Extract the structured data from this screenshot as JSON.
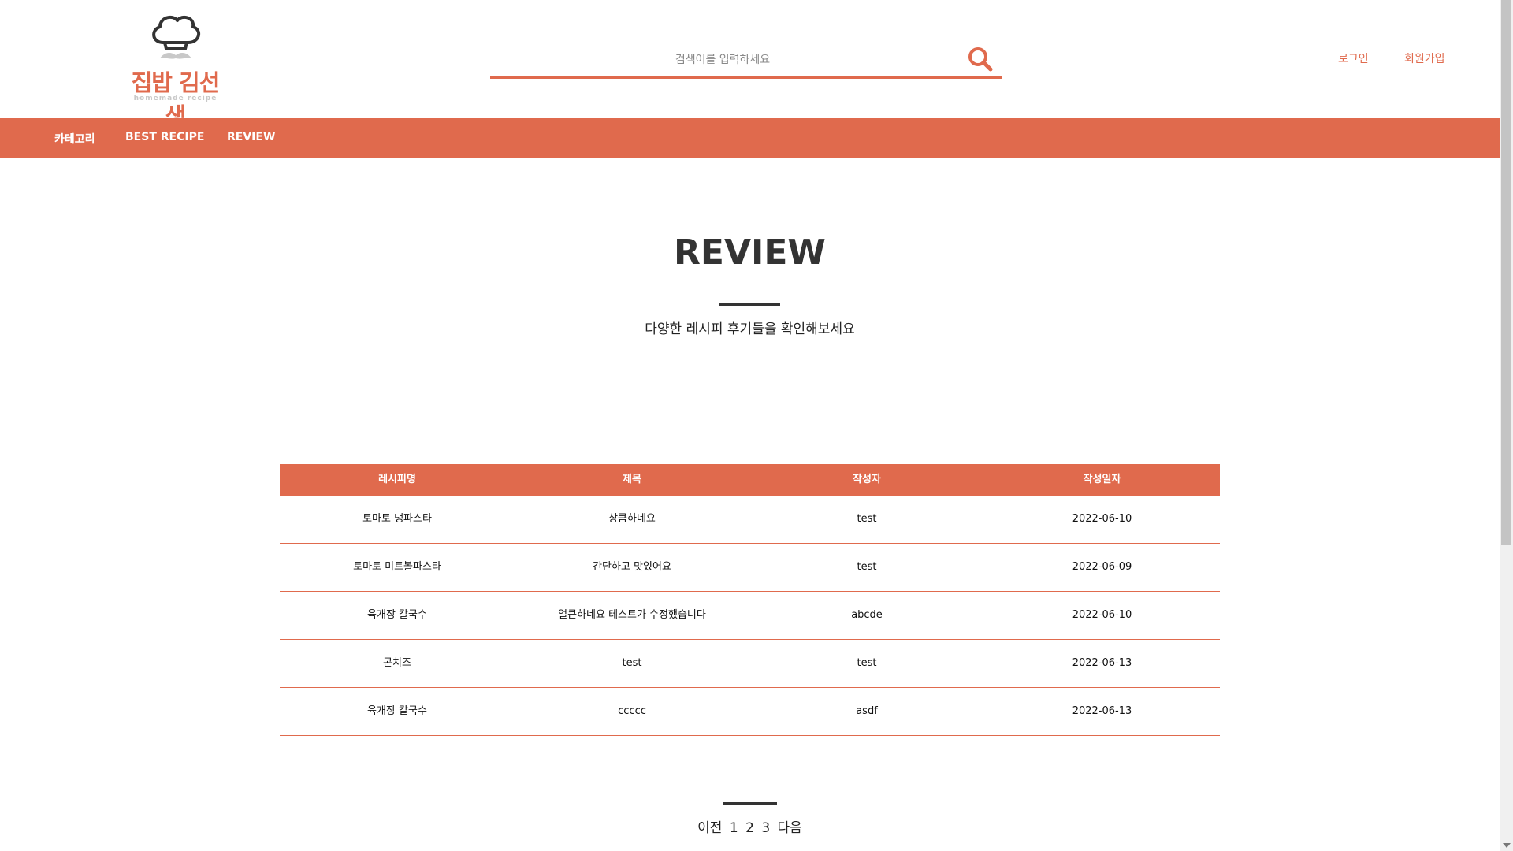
{
  "header": {
    "logo_title": "집밥 김선생",
    "logo_sub": "homemade recipe",
    "search_placeholder": "검색어를 입력하세요",
    "login_label": "로그인",
    "signup_label": "회원가입"
  },
  "nav": {
    "items": [
      {
        "label": "카테고리"
      },
      {
        "label": "BEST RECIPE"
      },
      {
        "label": "REVIEW"
      }
    ]
  },
  "main": {
    "title": "REVIEW",
    "subtitle": "다양한 레시피 후기들을 확인해보세요"
  },
  "table": {
    "headers": [
      "레시피명",
      "제목",
      "작성자",
      "작성일자"
    ],
    "rows": [
      [
        "토마토 냉파스타",
        "상큼하네요",
        "test",
        "2022-06-10"
      ],
      [
        "토마토 미트볼파스타",
        "간단하고 맛있어요",
        "test",
        "2022-06-09"
      ],
      [
        "육개장 칼국수",
        "얼큰하네요 테스트가 수정했습니다",
        "abcde",
        "2022-06-10"
      ],
      [
        "콘치즈",
        "test",
        "test",
        "2022-06-13"
      ],
      [
        "육개장 칼국수",
        "ccccc",
        "asdf",
        "2022-06-13"
      ]
    ]
  },
  "pagination": {
    "prev": "이전",
    "pages": [
      "1",
      "2",
      "3"
    ],
    "next": "다음"
  },
  "colors": {
    "accent": "#e06a4d",
    "text": "#222222"
  }
}
